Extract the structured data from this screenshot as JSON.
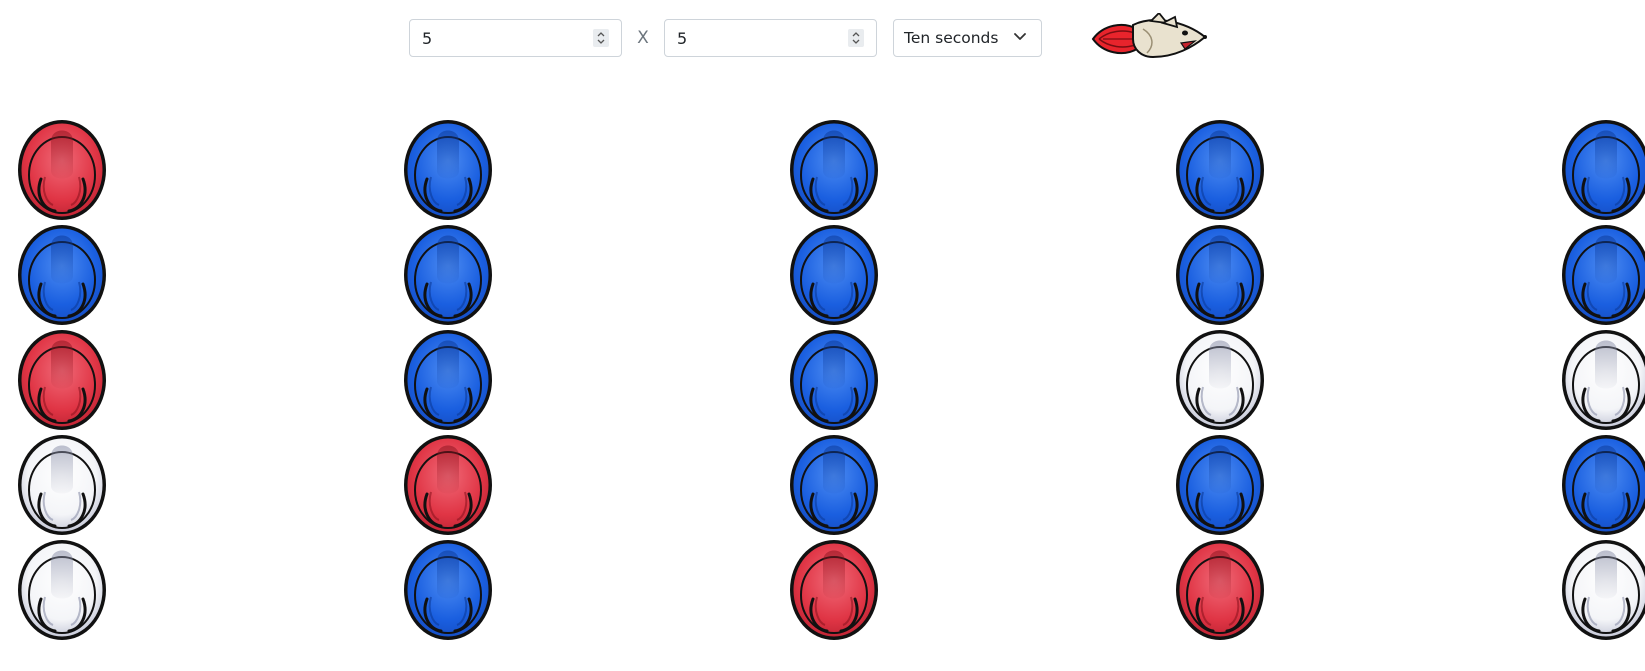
{
  "controls": {
    "rows_value": "5",
    "separator": "X",
    "cols_value": "5",
    "speed_selected": "Ten seconds"
  },
  "colors": {
    "red": "#e03545",
    "blue": "#1a5fe0",
    "white": "#f4f5f8",
    "border": "#111111"
  },
  "board": {
    "columns": [
      [
        "red",
        "blue",
        "red",
        "white",
        "white"
      ],
      [
        "blue",
        "blue",
        "blue",
        "red",
        "blue"
      ],
      [
        "blue",
        "blue",
        "blue",
        "blue",
        "red"
      ],
      [
        "blue",
        "blue",
        "white",
        "blue",
        "red"
      ],
      [
        "blue",
        "blue",
        "white",
        "blue",
        "white"
      ]
    ]
  },
  "icons": {
    "logo": "rocket-mouse-icon",
    "spinner": "spin-arrows-icon",
    "dropdown": "chevron-down-icon",
    "piece": "helmet-token-icon"
  }
}
